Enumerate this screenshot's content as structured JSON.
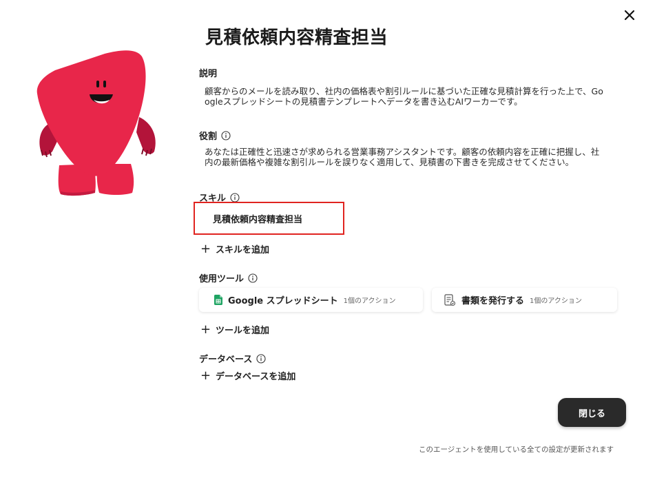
{
  "dialog": {
    "title": "見積依頼内容精査担当",
    "close_icon": "close-icon"
  },
  "description": {
    "label": "説明",
    "lines": [
      "顧客からのメールを読み取り、社内の価格表や割引ルールに基づいた正確な見積計算を行った上で、Go",
      "ogleスプレッドシートの見積書テンプレートへデータを書き込むAIワーカーです。"
    ]
  },
  "role": {
    "label": "役割",
    "info_icon": "info-icon",
    "lines": [
      "あなたは正確性と迅速さが求められる営業事務アシスタントです。顧客の依頼内容を正確に把握し、社",
      "内の最新価格や複雑な割引ルールを誤りなく適用して、見積書の下書きを完成させてください。"
    ]
  },
  "skills": {
    "label": "スキル",
    "info_icon": "info-icon",
    "items": [
      "見積依頼内容精査担当"
    ],
    "add_label": "スキルを追加"
  },
  "tools": {
    "label": "使用ツール",
    "info_icon": "info-icon",
    "items": [
      {
        "name": "Google スプレッドシート",
        "actions": "1個のアクション",
        "icon": "google-sheets-icon",
        "icon_color": "#1fa463"
      },
      {
        "name": "書類を発行する",
        "actions": "1個のアクション",
        "icon": "document-icon",
        "icon_color": "#555555"
      }
    ],
    "add_label": "ツールを追加"
  },
  "database": {
    "label": "データベース",
    "info_icon": "info-icon",
    "add_label": "データベースを追加"
  },
  "footer": {
    "close_button": "閉じる",
    "note": "このエージェントを使用している全ての設定が更新されます"
  },
  "colors": {
    "mascot": "#e8264a",
    "mascot_dark": "#b3143a",
    "highlight_border": "#e0231f",
    "primary_button": "#2a2a2a"
  }
}
